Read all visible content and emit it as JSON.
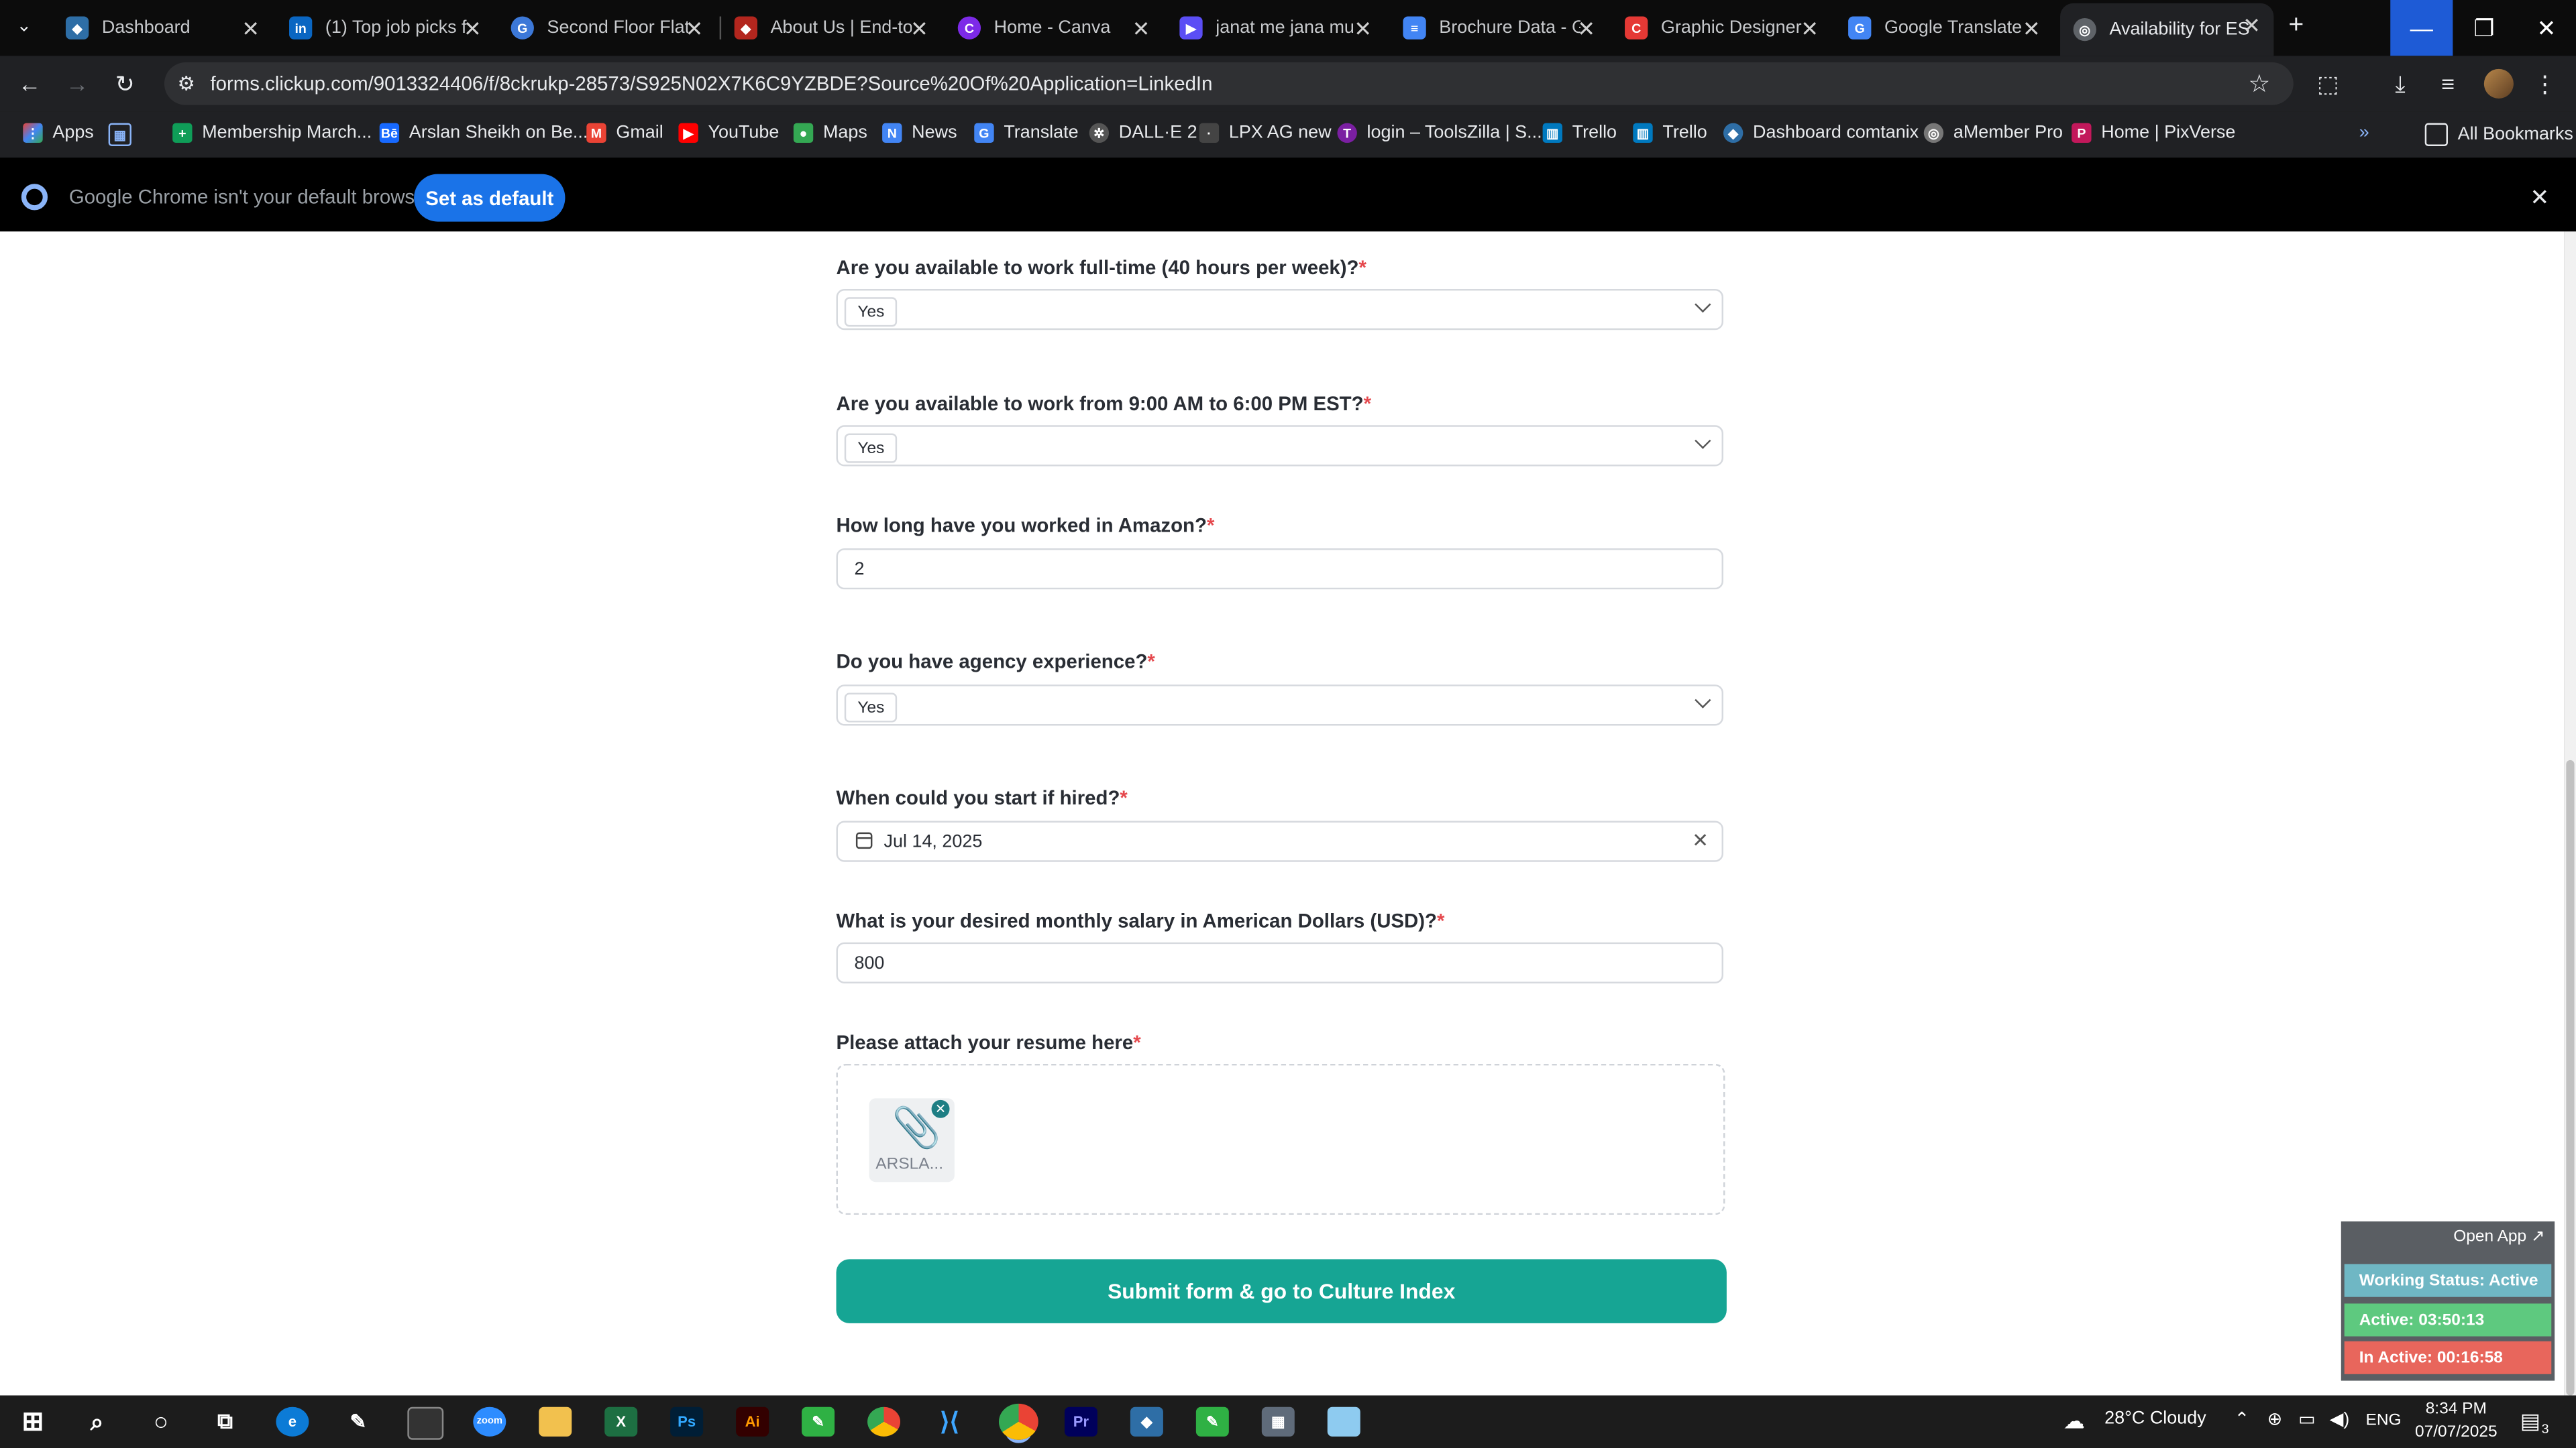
{
  "browser": {
    "tabs": [
      {
        "title": "Dashboard",
        "color": "#2e6ea6"
      },
      {
        "title": "(1) Top job picks f",
        "color": "#0a66c2"
      },
      {
        "title": "Second Floor Flat",
        "color": "#3c78d8"
      },
      {
        "title": "About Us | End-to",
        "color": "#b3261e"
      },
      {
        "title": "Home - Canva",
        "color": "#7d2ae8"
      },
      {
        "title": "janat me jana mu",
        "color": "#5b4ef5"
      },
      {
        "title": "Brochure Data - G",
        "color": "#4285f4"
      },
      {
        "title": "Graphic Designer",
        "color": "#e53935"
      },
      {
        "title": "Google Translate",
        "color": "#4285f4"
      },
      {
        "title": "Availability for ES",
        "color": "#888888"
      }
    ],
    "url": "forms.clickup.com/9013324406/f/8ckrukp-28573/S925N02X7K6C9YZBDE?Source%20Of%20Application=LinkedIn",
    "bookmarks": [
      {
        "label": "Apps",
        "color": "#ea4335"
      },
      {
        "label": "Membership March...",
        "color": "#0f9d58"
      },
      {
        "label": "Arslan Sheikh on Be...",
        "color": "#1769ff"
      },
      {
        "label": "Gmail",
        "color": "#ea4335"
      },
      {
        "label": "YouTube",
        "color": "#ff0000"
      },
      {
        "label": "Maps",
        "color": "#34a853"
      },
      {
        "label": "News",
        "color": "#4285f4"
      },
      {
        "label": "Translate",
        "color": "#4285f4"
      },
      {
        "label": "DALL·E 2",
        "color": "#555555"
      },
      {
        "label": "LPX AG new",
        "color": "#444444"
      },
      {
        "label": "login – ToolsZilla | S...",
        "color": "#7b1fa2"
      },
      {
        "label": "Trello",
        "color": "#0079bf"
      },
      {
        "label": "Trello",
        "color": "#0079bf"
      },
      {
        "label": "Dashboard comtanix",
        "color": "#2e6ea6"
      },
      {
        "label": "aMember Pro",
        "color": "#777777"
      },
      {
        "label": "Home | PixVerse",
        "color": "#c2185b"
      }
    ],
    "all_bookmarks": "All Bookmarks",
    "infobar_message": "Google Chrome isn't your default browser",
    "set_default": "Set as default"
  },
  "form": {
    "questions": [
      {
        "label": "Are you available to work full-time (40 hours per week)?",
        "type": "select",
        "value": "Yes"
      },
      {
        "label": "Are you available to work from 9:00 AM to 6:00 PM EST?",
        "type": "select",
        "value": "Yes"
      },
      {
        "label": "How long have you worked in Amazon?",
        "type": "text",
        "value": "2"
      },
      {
        "label": "Do you have agency experience?",
        "type": "select",
        "value": "Yes"
      },
      {
        "label": "When could you start if hired?",
        "type": "date",
        "value": "Jul 14, 2025"
      },
      {
        "label": "What is your desired monthly salary in American Dollars (USD)?",
        "type": "text",
        "value": "800"
      },
      {
        "label": "Please attach your resume here",
        "type": "file",
        "value": "ARSLA..."
      }
    ],
    "required_mark": "*",
    "submit_label": "Submit form & go to Culture Index"
  },
  "widget": {
    "open_app": "Open App ↗",
    "working_status": "Working Status: Active",
    "active": "Active: 03:50:13",
    "inactive": "In Active: 00:16:58",
    "colors": {
      "status": "#6fb7c4",
      "active": "#5ec97f",
      "inactive": "#e8665c"
    }
  },
  "taskbar": {
    "weather": "28°C  Cloudy",
    "lang": "ENG",
    "time": "8:34 PM",
    "date": "07/07/2025",
    "notifications": "3"
  }
}
